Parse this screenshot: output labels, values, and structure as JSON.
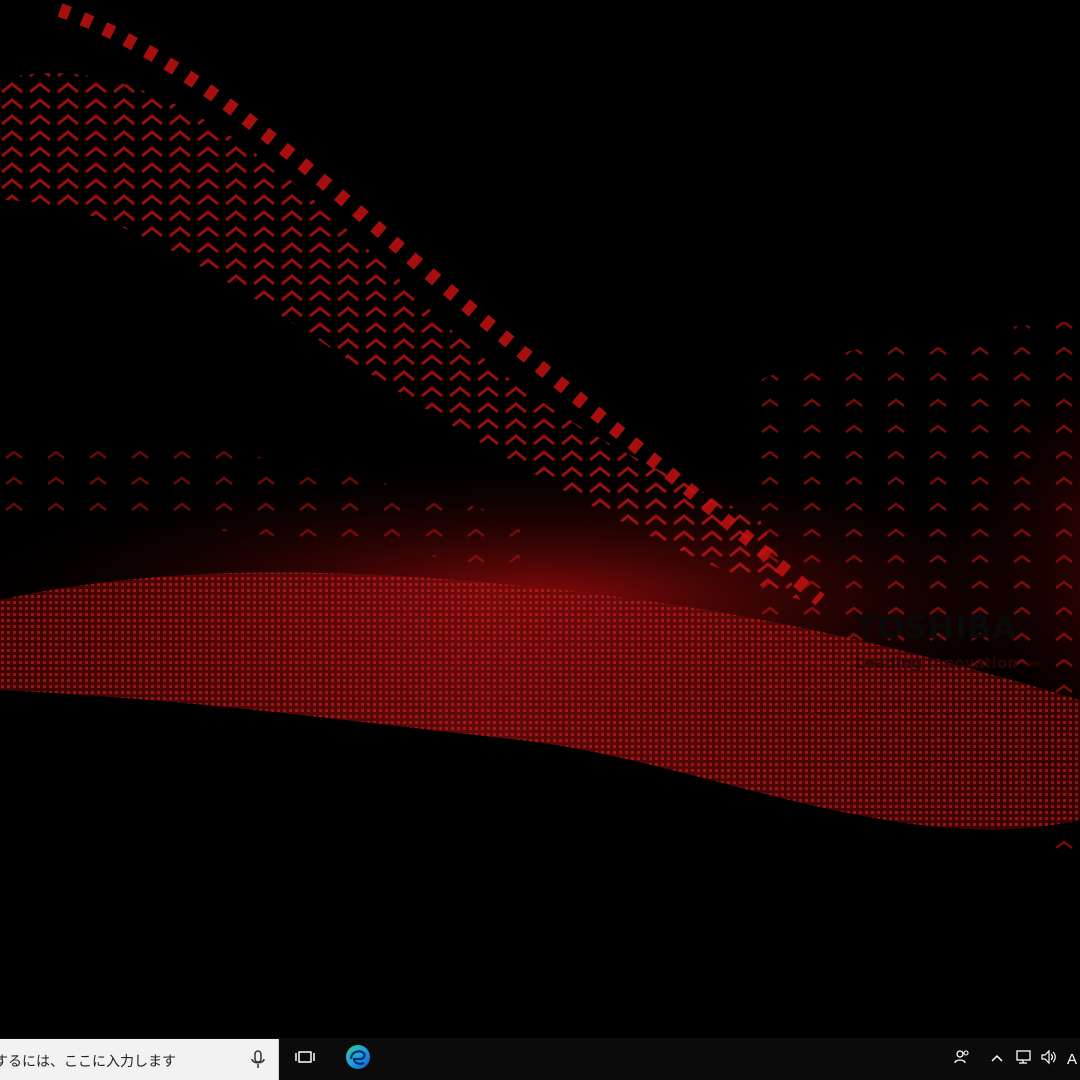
{
  "wallpaper": {
    "brand_name": "TOSHIBA",
    "tagline": "Leading Innovation",
    "tagline_chevrons": "»»",
    "colors": {
      "background": "#000000",
      "accent_red": "#e01818",
      "brand_text": "#0a0a0a"
    }
  },
  "taskbar": {
    "search": {
      "text": "するには、ここに入力します",
      "mic_icon": "microphone-icon"
    },
    "task_view_icon": "task-view-icon",
    "pinned": [
      {
        "name": "Microsoft Edge",
        "icon": "edge-icon"
      }
    ],
    "tray": {
      "people_icon": "people-icon",
      "overflow_icon": "chevron-up-icon",
      "network_icon": "network-icon",
      "volume_icon": "volume-icon",
      "ime_indicator": "A"
    }
  }
}
